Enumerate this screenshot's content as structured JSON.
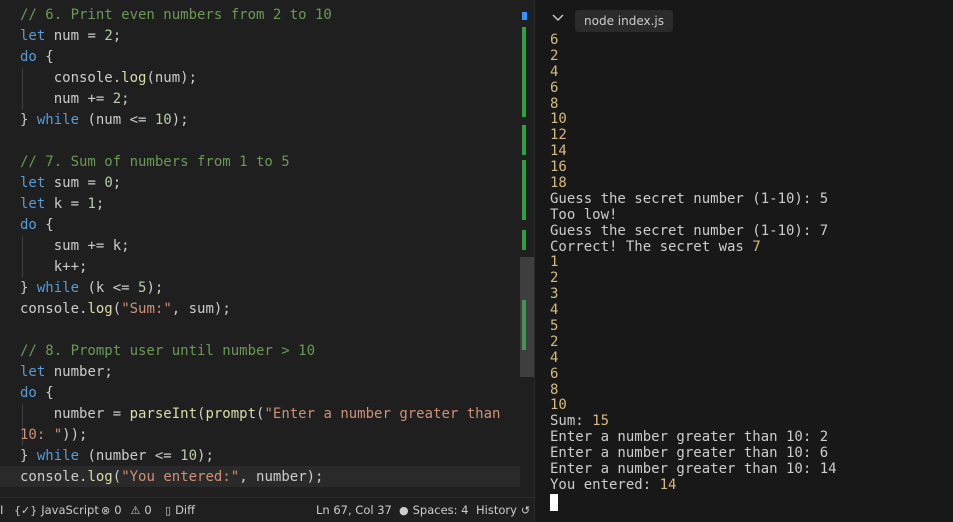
{
  "editor": {
    "lines": [
      [
        {
          "c": "cm",
          "t": "// 6. Print even numbers from 2 to 10"
        }
      ],
      [
        {
          "c": "kw",
          "t": "let"
        },
        {
          "c": "vr",
          "t": " num "
        },
        {
          "c": "pn",
          "t": "= "
        },
        {
          "c": "num",
          "t": "2"
        },
        {
          "c": "pn",
          "t": ";"
        }
      ],
      [
        {
          "c": "kw",
          "t": "do"
        },
        {
          "c": "pn",
          "t": " {"
        }
      ],
      [
        {
          "c": "vr",
          "t": "    console"
        },
        {
          "c": "pn",
          "t": "."
        },
        {
          "c": "fn",
          "t": "log"
        },
        {
          "c": "pn",
          "t": "(num);"
        }
      ],
      [
        {
          "c": "vr",
          "t": "    num "
        },
        {
          "c": "pn",
          "t": "+= "
        },
        {
          "c": "num",
          "t": "2"
        },
        {
          "c": "pn",
          "t": ";"
        }
      ],
      [
        {
          "c": "pn",
          "t": "} "
        },
        {
          "c": "kw",
          "t": "while"
        },
        {
          "c": "pn",
          "t": " (num <= "
        },
        {
          "c": "num",
          "t": "10"
        },
        {
          "c": "pn",
          "t": ");"
        }
      ],
      [
        {
          "c": "pn",
          "t": ""
        }
      ],
      [
        {
          "c": "cm",
          "t": "// 7. Sum of numbers from 1 to 5"
        }
      ],
      [
        {
          "c": "kw",
          "t": "let"
        },
        {
          "c": "vr",
          "t": " sum "
        },
        {
          "c": "pn",
          "t": "= "
        },
        {
          "c": "num",
          "t": "0"
        },
        {
          "c": "pn",
          "t": ";"
        }
      ],
      [
        {
          "c": "kw",
          "t": "let"
        },
        {
          "c": "vr",
          "t": " k "
        },
        {
          "c": "pn",
          "t": "= "
        },
        {
          "c": "num",
          "t": "1"
        },
        {
          "c": "pn",
          "t": ";"
        }
      ],
      [
        {
          "c": "kw",
          "t": "do"
        },
        {
          "c": "pn",
          "t": " {"
        }
      ],
      [
        {
          "c": "vr",
          "t": "    sum "
        },
        {
          "c": "pn",
          "t": "+= k;"
        }
      ],
      [
        {
          "c": "vr",
          "t": "    k"
        },
        {
          "c": "pn",
          "t": "++;"
        }
      ],
      [
        {
          "c": "pn",
          "t": "} "
        },
        {
          "c": "kw",
          "t": "while"
        },
        {
          "c": "pn",
          "t": " (k <= "
        },
        {
          "c": "num",
          "t": "5"
        },
        {
          "c": "pn",
          "t": ");"
        }
      ],
      [
        {
          "c": "vr",
          "t": "console"
        },
        {
          "c": "pn",
          "t": "."
        },
        {
          "c": "fn",
          "t": "log"
        },
        {
          "c": "pn",
          "t": "("
        },
        {
          "c": "st",
          "t": "\"Sum:\""
        },
        {
          "c": "pn",
          "t": ", sum);"
        }
      ],
      [
        {
          "c": "pn",
          "t": ""
        }
      ],
      [
        {
          "c": "cm",
          "t": "// 8. Prompt user until number > 10"
        }
      ],
      [
        {
          "c": "kw",
          "t": "let"
        },
        {
          "c": "vr",
          "t": " number"
        },
        {
          "c": "pn",
          "t": ";"
        }
      ],
      [
        {
          "c": "kw",
          "t": "do"
        },
        {
          "c": "pn",
          "t": " {"
        }
      ],
      [
        {
          "c": "vr",
          "t": "    number "
        },
        {
          "c": "pn",
          "t": "= "
        },
        {
          "c": "fn",
          "t": "parseInt"
        },
        {
          "c": "pn",
          "t": "("
        },
        {
          "c": "fn",
          "t": "prompt"
        },
        {
          "c": "pn",
          "t": "("
        },
        {
          "c": "st",
          "t": "\"Enter a number greater than"
        }
      ],
      [
        {
          "c": "st",
          "t": "10: \""
        },
        {
          "c": "pn",
          "t": "));"
        }
      ],
      [
        {
          "c": "pn",
          "t": "} "
        },
        {
          "c": "kw",
          "t": "while"
        },
        {
          "c": "pn",
          "t": " (number <= "
        },
        {
          "c": "num",
          "t": "10"
        },
        {
          "c": "pn",
          "t": ");"
        }
      ],
      [
        {
          "c": "vr",
          "t": "console"
        },
        {
          "c": "pn",
          "t": "."
        },
        {
          "c": "fn",
          "t": "log"
        },
        {
          "c": "pn",
          "t": "("
        },
        {
          "c": "st",
          "t": "\"You entered:\""
        },
        {
          "c": "pn",
          "t": ", number);"
        }
      ]
    ]
  },
  "terminal": {
    "tab_label": "node index.js",
    "lines": [
      [
        {
          "c": "t-num",
          "t": "6"
        }
      ],
      [
        {
          "c": "t-num",
          "t": "2"
        }
      ],
      [
        {
          "c": "t-num",
          "t": "4"
        }
      ],
      [
        {
          "c": "t-num",
          "t": "6"
        }
      ],
      [
        {
          "c": "t-num",
          "t": "8"
        }
      ],
      [
        {
          "c": "t-num",
          "t": "10"
        }
      ],
      [
        {
          "c": "t-num",
          "t": "12"
        }
      ],
      [
        {
          "c": "t-num",
          "t": "14"
        }
      ],
      [
        {
          "c": "t-num",
          "t": "16"
        }
      ],
      [
        {
          "c": "t-num",
          "t": "18"
        }
      ],
      [
        {
          "c": "",
          "t": "Guess the secret number (1-10): 5"
        }
      ],
      [
        {
          "c": "",
          "t": "Too low!"
        }
      ],
      [
        {
          "c": "",
          "t": "Guess the secret number (1-10): 7"
        }
      ],
      [
        {
          "c": "",
          "t": "Correct! The secret was "
        },
        {
          "c": "t-num",
          "t": "7"
        }
      ],
      [
        {
          "c": "t-num",
          "t": "1"
        }
      ],
      [
        {
          "c": "t-num",
          "t": "2"
        }
      ],
      [
        {
          "c": "t-num",
          "t": "3"
        }
      ],
      [
        {
          "c": "t-num",
          "t": "4"
        }
      ],
      [
        {
          "c": "t-num",
          "t": "5"
        }
      ],
      [
        {
          "c": "t-num",
          "t": "2"
        }
      ],
      [
        {
          "c": "t-num",
          "t": "4"
        }
      ],
      [
        {
          "c": "t-num",
          "t": "6"
        }
      ],
      [
        {
          "c": "t-num",
          "t": "8"
        }
      ],
      [
        {
          "c": "t-num",
          "t": "10"
        }
      ],
      [
        {
          "c": "",
          "t": "Sum: "
        },
        {
          "c": "t-num",
          "t": "15"
        }
      ],
      [
        {
          "c": "",
          "t": "Enter a number greater than 10: 2"
        }
      ],
      [
        {
          "c": "",
          "t": "Enter a number greater than 10: 6"
        }
      ],
      [
        {
          "c": "",
          "t": "Enter a number greater than 10: 14"
        }
      ],
      [
        {
          "c": "",
          "t": "You entered: "
        },
        {
          "c": "t-num",
          "t": "14"
        }
      ]
    ]
  },
  "status": {
    "edge_glyph": "I",
    "language": "JavaScript",
    "errors": "0",
    "warnings": "0",
    "diff": "Diff",
    "position": "Ln 67, Col 37",
    "spaces": "Spaces: 4",
    "history": "History"
  },
  "colors": {
    "keyword": "#569cd6",
    "comment": "#6a9955",
    "number": "#b5cea8",
    "string": "#ce9178",
    "function": "#dcdcaa",
    "terminal_number": "#d7ba7d"
  }
}
